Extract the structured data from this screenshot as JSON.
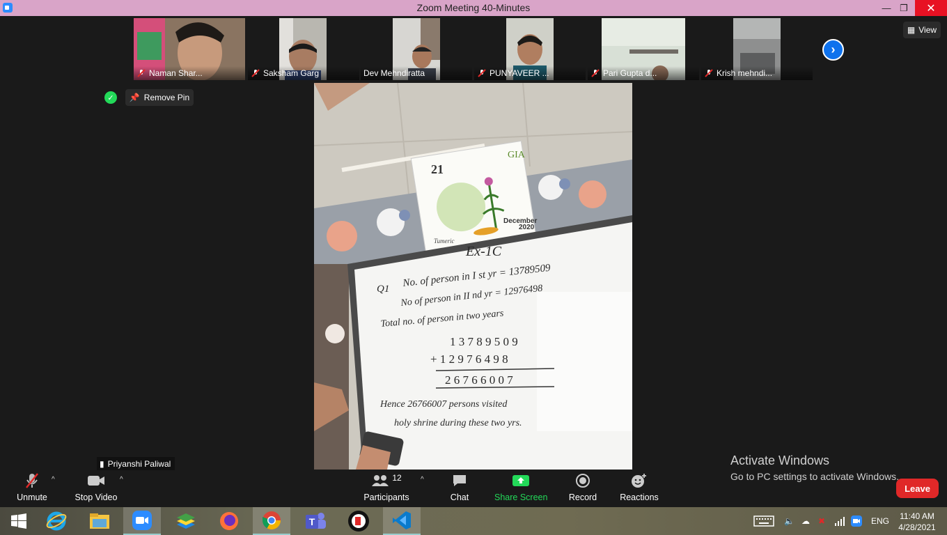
{
  "window": {
    "title": "Zoom Meeting 40-Minutes",
    "min": "—",
    "max": "❐",
    "close": "✕"
  },
  "thumbnails": [
    {
      "name": "Naman Shar..."
    },
    {
      "name": "Saksham Garg"
    },
    {
      "name": "Dev Mehndiratta"
    },
    {
      "name": "PUNYAVEER ..."
    },
    {
      "name": "Pari Gupta d..."
    },
    {
      "name": "Krish mehndi..."
    }
  ],
  "view_button": "View",
  "remove_pin": "Remove Pin",
  "speaker_name": "Priyanshi Paliwal",
  "whiteboard": {
    "calendar_brand": "GIA",
    "calendar_year_mark": "21",
    "calendar_month": "December",
    "calendar_year": "2020",
    "calendar_caption": "Tumeric",
    "heading": "Ex-1C",
    "q_label": "Q1",
    "line1": "No. of person in I st yr = 13789509",
    "line2": "No of person in II nd yr = 12976498",
    "line3": "Total no. of person in two years",
    "sum_a": "1 3 7 8 9 5 0 9",
    "sum_b": "+ 1 2 9 7 6 4 9 8",
    "sum_total": "2 6 7 6 6 0 0 7",
    "answer1": "Hence 26766007 persons visited",
    "answer2": "holy shrine during these two yrs."
  },
  "activate": {
    "title": "Activate Windows",
    "subtitle": "Go to PC settings to activate Windows."
  },
  "toolbar": {
    "unmute": "Unmute",
    "stop_video": "Stop Video",
    "participants": "Participants",
    "participants_count": "12",
    "chat": "Chat",
    "share_screen": "Share Screen",
    "record": "Record",
    "reactions": "Reactions",
    "leave": "Leave"
  },
  "taskbar": {
    "language": "ENG",
    "time": "11:40 AM",
    "date": "4/28/2021"
  },
  "colors": {
    "share_green": "#23d959",
    "leave_red": "#e02828",
    "zoom_blue": "#0e72ed"
  }
}
